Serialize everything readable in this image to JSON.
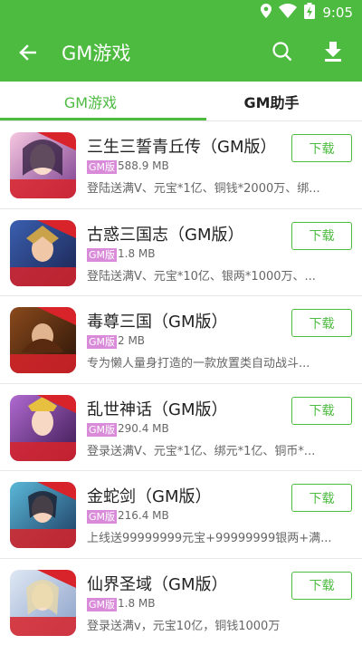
{
  "status_bar": {
    "time": "9:05",
    "icons": [
      "location-icon",
      "wifi-icon",
      "battery-charging-icon"
    ]
  },
  "app_bar": {
    "title": "GM游戏",
    "back_icon": "back-arrow-icon",
    "search_icon": "search-icon",
    "download_icon": "download-icon"
  },
  "tabs": [
    {
      "label": "GM游戏",
      "active": true
    },
    {
      "label": "GM助手",
      "active": false
    }
  ],
  "colors": {
    "accent": "#4cbb3f",
    "badge": "#d98bd9"
  },
  "games": [
    {
      "name": "三生三誓青丘传（GM版）",
      "badge": "GM版",
      "size": "588.9 MB",
      "desc": "登陆送满V、元宝*1亿、铜钱*2000万、绑...",
      "button": "下载",
      "icon_caption": "送9亿9999万元宝",
      "icon_ribbon": "免费无限"
    },
    {
      "name": "古惑三国志（GM版）",
      "badge": "GM版",
      "size": "1.8 MB",
      "desc": "登陆送满V、元宝*10亿、银两*1000万、...",
      "button": "下载",
      "icon_caption": "送9亿9999万元宝",
      "icon_ribbon": "免费无限"
    },
    {
      "name": "毒尊三国（GM版）",
      "badge": "GM版",
      "size": "2 MB",
      "desc": "专为懒人量身打造的一款放置类自动战斗...",
      "button": "下载",
      "icon_caption": "送9亿9999万元宝",
      "icon_ribbon": "免费无限"
    },
    {
      "name": "乱世神话（GM版）",
      "badge": "GM版",
      "size": "290.4 MB",
      "desc": "登录送满V、元宝*1亿、绑元*1亿、铜币*...",
      "button": "下载",
      "icon_caption": "送9亿9999万元宝",
      "icon_ribbon": "免费无限"
    },
    {
      "name": "金蛇剑（GM版）",
      "badge": "GM版",
      "size": "216.4 MB",
      "desc": "上线送99999999元宝+99999999银两+满...",
      "button": "下载",
      "icon_caption": "送9亿9999万元宝",
      "icon_ribbon": "免费无限"
    },
    {
      "name": "仙界圣域（GM版）",
      "badge": "GM版",
      "size": "1.8 MB",
      "desc": "登录送满v，元宝10亿，铜钱1000万",
      "button": "下载",
      "icon_caption": "送9亿9999万元宝",
      "icon_ribbon": "免费无限"
    }
  ]
}
